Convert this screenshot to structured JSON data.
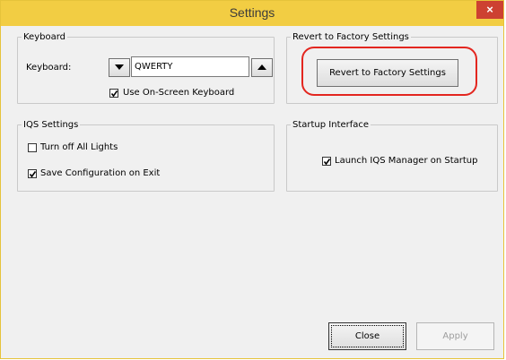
{
  "window": {
    "title": "Settings",
    "close_glyph": "×"
  },
  "keyboard_group": {
    "legend": "Keyboard",
    "keyboard_label": "Keyboard:",
    "down_icon": "triangle-down-icon",
    "value": "QWERTY",
    "up_icon": "triangle-up-icon",
    "onscreen_label": "Use On-Screen Keyboard",
    "onscreen_checked": true
  },
  "factory_group": {
    "legend": "Revert to Factory Settings",
    "button_label": "Revert to Factory Settings",
    "highlight_color": "#e3261f"
  },
  "iqs_group": {
    "legend": "IQS Settings",
    "lights_label": "Turn off All Lights",
    "lights_checked": false,
    "save_label": "Save Configuration on Exit",
    "save_checked": true
  },
  "startup_group": {
    "legend": "Startup Interface",
    "launch_label": "Launch IQS Manager on Startup",
    "launch_checked": true
  },
  "buttons": {
    "close": "Close",
    "apply": "Apply"
  },
  "colors": {
    "titlebar": "#f2cd43",
    "close_button": "#cd4131"
  }
}
